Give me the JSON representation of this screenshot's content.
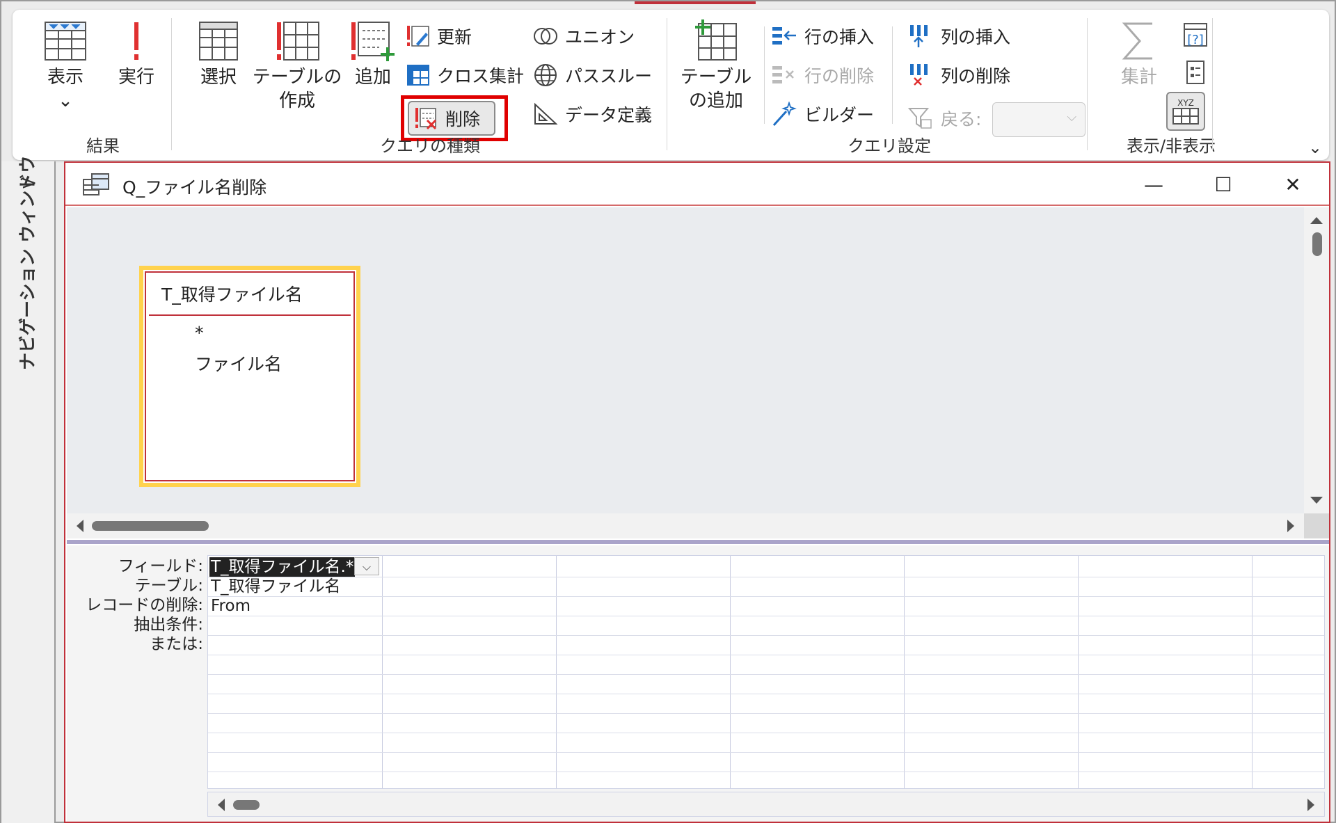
{
  "ribbon": {
    "groups": {
      "results": "結果",
      "query_type": "クエリの種類",
      "query_setup": "クエリ設定",
      "show_hide": "表示/非表示"
    },
    "view_label": "表示",
    "view_chevron": "⌄",
    "run_label": "実行",
    "select_label": "選択",
    "make_table_label_1": "テーブルの",
    "make_table_label_2": "作成",
    "append_label": "追加",
    "update_label": "更新",
    "crosstab_label": "クロス集計",
    "delete_label": "削除",
    "union_label": "ユニオン",
    "passthrough_label": "パススルー",
    "data_definition_label": "データ定義",
    "add_table_label_1": "テーブル",
    "add_table_label_2": "の追加",
    "insert_rows_label": "行の挿入",
    "delete_rows_label": "行の削除",
    "builder_label": "ビルダー",
    "insert_columns_label": "列の挿入",
    "delete_columns_label": "列の削除",
    "return_label": "戻る:",
    "totals_label": "集計",
    "xyz_label": "XYZ",
    "collapse": "⌄"
  },
  "nav": {
    "chevron": ">",
    "label": "ナビゲーション ウィンドウ"
  },
  "query_window": {
    "title": "Q_ファイル名削除",
    "minimize": "—",
    "maximize": "☐",
    "close": "✕"
  },
  "table_box": {
    "title": "T_取得ファイル名",
    "fields": [
      "*",
      "ファイル名"
    ]
  },
  "grid": {
    "row_labels": [
      "フィールド:",
      "テーブル:",
      "レコードの削除:",
      "抽出条件:",
      "または:"
    ],
    "columns": [
      {
        "field": "T_取得ファイル名.*",
        "table": "T_取得ファイル名",
        "delete": "From",
        "criteria": "",
        "or": ""
      }
    ],
    "dropdown": "⌵"
  },
  "colors": {
    "accent_red": "#c0303a",
    "highlight_red": "#e00000",
    "table_highlight": "#ffd24d"
  }
}
